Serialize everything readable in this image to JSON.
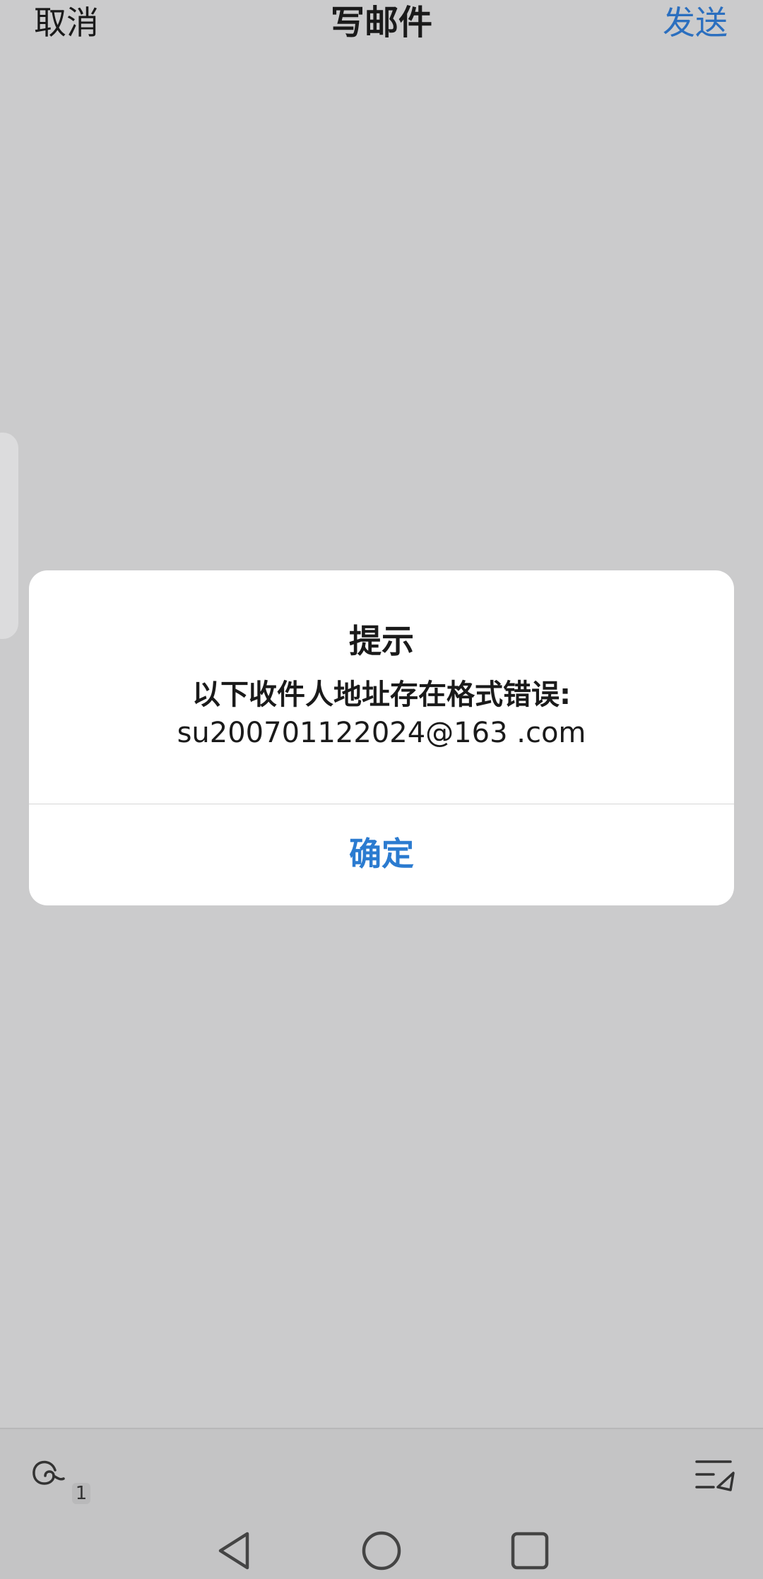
{
  "header": {
    "cancel_label": "取消",
    "title": "写邮件",
    "send_label": "发送"
  },
  "dialog": {
    "title": "提示",
    "message": "以下收件人地址存在格式错误:",
    "address": "su200701122024@163 .com",
    "ok_label": "确定"
  },
  "toolbar": {
    "left_icon": "signature-loop-icon",
    "left_badge": "1",
    "right_icon": "compose-list-send-icon"
  },
  "navbar": {
    "back_icon": "back-triangle-icon",
    "home_icon": "home-circle-icon",
    "recents_icon": "recents-square-icon"
  },
  "colors": {
    "backdrop": "#cbcbcc",
    "accent_blue": "#2b6fbf",
    "dialog_bg": "#ffffff",
    "text_dark": "#1a1a1a"
  }
}
